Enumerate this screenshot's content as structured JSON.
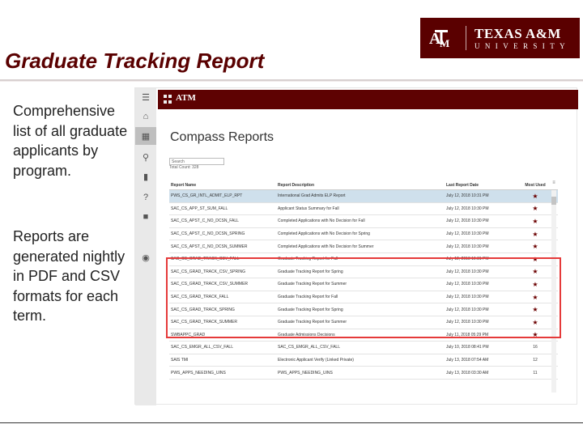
{
  "slide": {
    "title": "Graduate Tracking Report",
    "logo_line1": "TEXAS A&M",
    "logo_line2": "UNIVERSITY",
    "bullets": [
      "Comprehensive list of all graduate applicants by program.",
      "Reports are generated nightly in PDF and CSV formats for each term."
    ]
  },
  "app": {
    "page_title": "Compass Reports",
    "search_label": "Search",
    "total_count": "Total Count: 328",
    "brand_color": "#5e0202",
    "sidebar_icons": [
      "menu-icon",
      "home-icon",
      "grid-icon",
      "search-icon",
      "folder-icon",
      "help-icon",
      "lock-icon",
      "user-icon"
    ],
    "table": {
      "headers": [
        "Report Name",
        "Report Description",
        "Last Report Date",
        "Most Used"
      ],
      "rows": [
        {
          "name": "PWS_CS_GR_INTL_ADMIT_ELP_RPT",
          "desc": "International Grad Admits ELP Report",
          "date": "July 12, 2018 10:31 PM",
          "used": "★",
          "sel": true
        },
        {
          "name": "SAC_CS_APP_ST_SUM_FALL",
          "desc": "Applicant Status Summary for Fall",
          "date": "July 12, 2018 10:30 PM",
          "used": "★"
        },
        {
          "name": "SAC_CS_APST_C_NO_DCSN_FALL",
          "desc": "Completed Applications with No Decision for Fall",
          "date": "July 12, 2018 10:30 PM",
          "used": "★"
        },
        {
          "name": "SAC_CS_APST_C_NO_DCSN_SPRING",
          "desc": "Completed Applications with No Decision for Spring",
          "date": "July 12, 2018 10:30 PM",
          "used": "★"
        },
        {
          "name": "SAC_CS_APST_C_NO_DCSN_SUMMER",
          "desc": "Completed Applications with No Decision for Summer",
          "date": "July 12, 2018 10:30 PM",
          "used": "★"
        },
        {
          "name": "SAC_CS_GRAD_TRACK_CSV_FALL",
          "desc": "Graduate Tracking Report for Fall",
          "date": "July 12, 2018 10:31 PM",
          "used": "★"
        },
        {
          "name": "SAC_CS_GRAD_TRACK_CSV_SPRING",
          "desc": "Graduate Tracking Report for Spring",
          "date": "July 12, 2018 10:30 PM",
          "used": "★"
        },
        {
          "name": "SAC_CS_GRAD_TRACK_CSV_SUMMER",
          "desc": "Graduate Tracking Report for Summer",
          "date": "July 12, 2018 10:30 PM",
          "used": "★"
        },
        {
          "name": "SAC_CS_GRAD_TRACK_FALL",
          "desc": "Graduate Tracking Report for Fall",
          "date": "July 12, 2018 10:30 PM",
          "used": "★"
        },
        {
          "name": "SAC_CS_GRAD_TRACK_SPRING",
          "desc": "Graduate Tracking Report for Spring",
          "date": "July 12, 2018 10:30 PM",
          "used": "★"
        },
        {
          "name": "SAC_CS_GRAD_TRACK_SUMMER",
          "desc": "Graduate Tracking Report for Summer",
          "date": "July 12, 2018 10:30 PM",
          "used": "★"
        },
        {
          "name": "SWBAPPC_GRAD",
          "desc": "Graduate Admissions Decisions",
          "date": "July 11, 2018 05:29 PM",
          "used": "★"
        },
        {
          "name": "SAC_CS_EMGR_ALL_CSV_FALL",
          "desc": "SAC_CS_EMGR_ALL_CSV_FALL",
          "date": "July 10, 2018 08:41 PM",
          "used": "16"
        },
        {
          "name": "SAIS TMI",
          "desc": "Electronic Applicant Verify (Linked Private)",
          "date": "July 13, 2018 07:54 AM",
          "used": "12"
        },
        {
          "name": "PWS_APPS_NEEDING_UINS",
          "desc": "PWS_APPS_NEEDING_UINS",
          "date": "July 13, 2018 03:30 AM",
          "used": "11"
        }
      ]
    }
  },
  "colors": {
    "title": "#5a0000",
    "highlight": "#e53a3a",
    "star": "#6b0000"
  }
}
